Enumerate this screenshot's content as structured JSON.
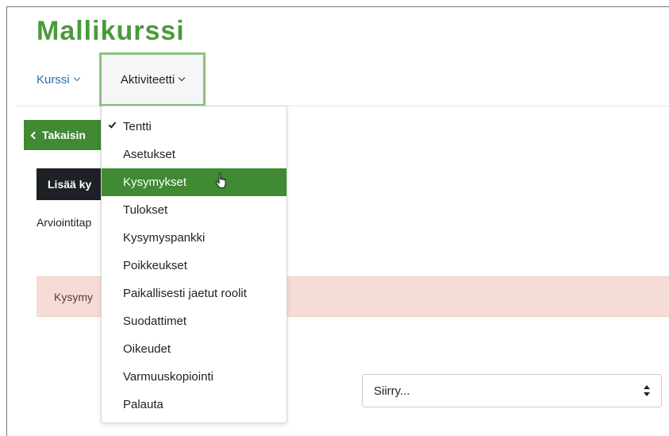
{
  "course": {
    "title": "Mallikurssi"
  },
  "nav": {
    "items": [
      {
        "label": "Kurssi"
      },
      {
        "label": "Aktiviteetti"
      }
    ]
  },
  "back_button": {
    "label": "Takaisin"
  },
  "add_button": {
    "label": "Lisää ky"
  },
  "grading": {
    "text": "Arviointitap"
  },
  "alert": {
    "text": "Kysymy"
  },
  "jump_select": {
    "value": "Siirry..."
  },
  "dropdown": {
    "items": [
      {
        "label": "Tentti",
        "checked": true
      },
      {
        "label": "Asetukset"
      },
      {
        "label": "Kysymykset",
        "active": true
      },
      {
        "label": "Tulokset"
      },
      {
        "label": "Kysymyspankki"
      },
      {
        "label": "Poikkeukset"
      },
      {
        "label": "Paikallisesti jaetut roolit"
      },
      {
        "label": "Suodattimet"
      },
      {
        "label": "Oikeudet"
      },
      {
        "label": "Varmuuskopiointi"
      },
      {
        "label": "Palauta"
      }
    ]
  },
  "colors": {
    "brand_green": "#4a9a3c",
    "button_green": "#3f8a33",
    "link_blue": "#2f6fa8",
    "alert_bg": "#f5dcd5",
    "dark_button": "#1d2125"
  }
}
